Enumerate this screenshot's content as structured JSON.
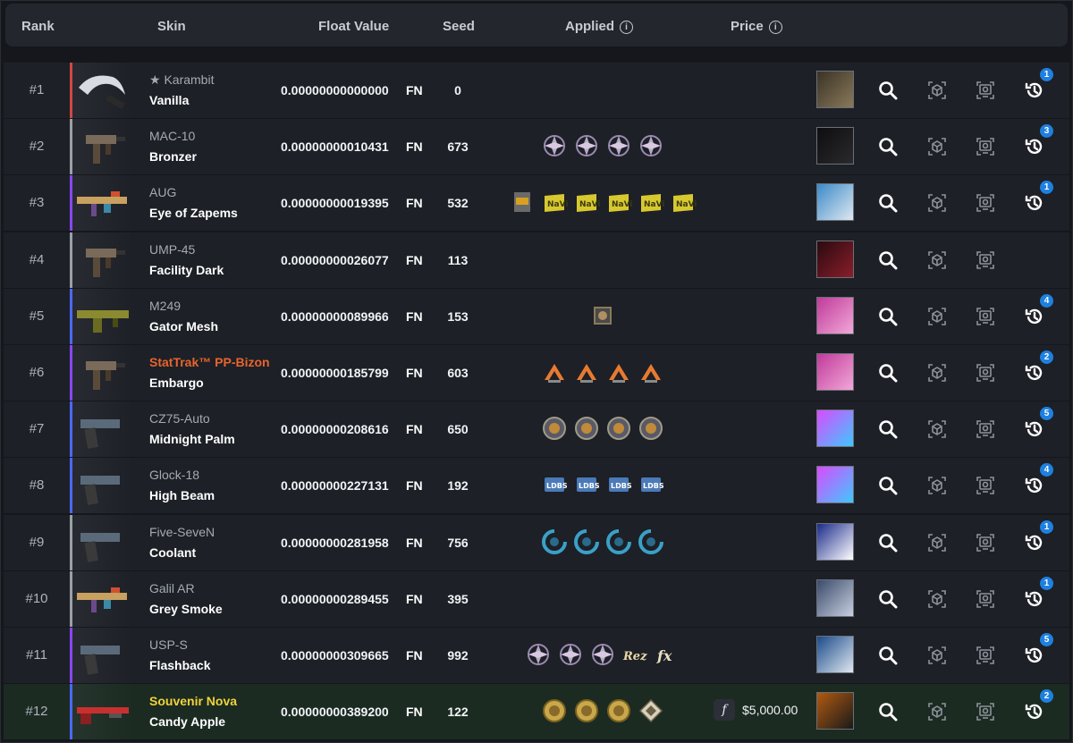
{
  "header": {
    "rank": "Rank",
    "skin": "Skin",
    "float_value": "Float Value",
    "seed": "Seed",
    "applied": "Applied",
    "price": "Price"
  },
  "colors": {
    "accent_badge": "#1e80e0",
    "stattrak": "#e8642e",
    "souvenir": "#f2d23a",
    "row_bg": "#1d2026",
    "souvenir_row_bg": "#1b2b22"
  },
  "icons": {
    "inspect": "magnifier-icon",
    "3d_view": "cube-scan-icon",
    "screenshot": "screen-inspect-icon",
    "history": "history-icon",
    "info": "info-icon",
    "float": "float-f-icon"
  },
  "rows": [
    {
      "rank": "#1",
      "weapon": "★ Karambit",
      "skin": "Vanilla",
      "float": "0.00000000000000",
      "wear": "FN",
      "seed": "0",
      "stickers": [],
      "price": "",
      "history_count": "1",
      "rarity": "#d24646",
      "name_color": "#a5aab4",
      "avatar": [
        "#3a3226",
        "#8a7a5a"
      ],
      "weapon_icon": "karambit"
    },
    {
      "rank": "#2",
      "weapon": "MAC-10",
      "skin": "Bronzer",
      "float": "0.00000000010431",
      "wear": "FN",
      "seed": "673",
      "stickers": [
        "nip",
        "nip",
        "nip",
        "nip"
      ],
      "price": "",
      "history_count": "3",
      "rarity": "#9aa0a8",
      "name_color": "#a5aab4",
      "avatar": [
        "#0e0e10",
        "#2a2a2e"
      ],
      "weapon_icon": "smg"
    },
    {
      "rank": "#3",
      "weapon": "AUG",
      "skin": "Eye of Zapems",
      "float": "0.00000000019395",
      "wear": "FN",
      "seed": "532",
      "stickers": [
        "box",
        "navi",
        "navi",
        "navi",
        "navi",
        "navi"
      ],
      "price": "",
      "history_count": "1",
      "rarity": "#8847ff",
      "name_color": "#a5aab4",
      "avatar": [
        "#3a8ac8",
        "#dfe8f0"
      ],
      "weapon_icon": "rifle"
    },
    {
      "rank": "#4",
      "weapon": "UMP-45",
      "skin": "Facility Dark",
      "float": "0.00000000026077",
      "wear": "FN",
      "seed": "113",
      "stickers": [],
      "price": "",
      "history_count": "",
      "rarity": "#9aa0a8",
      "name_color": "#a5aab4",
      "avatar": [
        "#2a0a10",
        "#8a1e2a"
      ],
      "weapon_icon": "smg"
    },
    {
      "rank": "#5",
      "weapon": "M249",
      "skin": "Gator Mesh",
      "float": "0.00000000089966",
      "wear": "FN",
      "seed": "153",
      "stickers": [
        "holo"
      ],
      "price": "",
      "history_count": "4",
      "rarity": "#4b69ff",
      "name_color": "#a5aab4",
      "avatar": [
        "#c03a9a",
        "#f2a8d8"
      ],
      "weapon_icon": "mg"
    },
    {
      "rank": "#6",
      "weapon": "StatTrak™ PP-Bizon",
      "skin": "Embargo",
      "float": "0.00000000185799",
      "wear": "FN",
      "seed": "603",
      "stickers": [
        "a",
        "a",
        "a",
        "a"
      ],
      "price": "",
      "history_count": "2",
      "rarity": "#8847ff",
      "name_color": "#e8642e",
      "avatar": [
        "#c03a9a",
        "#f2a8d8"
      ],
      "weapon_icon": "smg"
    },
    {
      "rank": "#7",
      "weapon": "CZ75-Auto",
      "skin": "Midnight Palm",
      "float": "0.00000000208616",
      "wear": "FN",
      "seed": "650",
      "stickers": [
        "coin",
        "coin",
        "coin",
        "coin"
      ],
      "price": "",
      "history_count": "5",
      "rarity": "#4b69ff",
      "name_color": "#a5aab4",
      "avatar": [
        "#d94bff",
        "#3fc8ff"
      ],
      "weapon_icon": "pistol"
    },
    {
      "rank": "#8",
      "weapon": "Glock-18",
      "skin": "High Beam",
      "float": "0.00000000227131",
      "wear": "FN",
      "seed": "192",
      "stickers": [
        "ldbs",
        "ldbs",
        "ldbs",
        "ldbs"
      ],
      "price": "",
      "history_count": "4",
      "rarity": "#4b69ff",
      "name_color": "#a5aab4",
      "avatar": [
        "#d94bff",
        "#3fc8ff"
      ],
      "weapon_icon": "pistol"
    },
    {
      "rank": "#9",
      "weapon": "Five-SeveN",
      "skin": "Coolant",
      "float": "0.00000000281958",
      "wear": "FN",
      "seed": "756",
      "stickers": [
        "liquid",
        "liquid",
        "liquid",
        "liquid"
      ],
      "price": "",
      "history_count": "1",
      "rarity": "#9aa0a8",
      "name_color": "#a5aab4",
      "avatar": [
        "#1a2a8a",
        "#ffffff"
      ],
      "weapon_icon": "pistol"
    },
    {
      "rank": "#10",
      "weapon": "Galil AR",
      "skin": "Grey Smoke",
      "float": "0.00000000289455",
      "wear": "FN",
      "seed": "395",
      "stickers": [],
      "price": "",
      "history_count": "1",
      "rarity": "#9aa0a8",
      "name_color": "#a5aab4",
      "avatar": [
        "#3a4a6a",
        "#c8d0e0"
      ],
      "weapon_icon": "rifle"
    },
    {
      "rank": "#11",
      "weapon": "USP-S",
      "skin": "Flashback",
      "float": "0.00000000309665",
      "wear": "FN",
      "seed": "992",
      "stickers": [
        "nip",
        "nip",
        "nip",
        "rez",
        "fx"
      ],
      "price": "",
      "history_count": "5",
      "rarity": "#8847ff",
      "name_color": "#a5aab4",
      "avatar": [
        "#1a4a8a",
        "#e0e8f0"
      ],
      "weapon_icon": "pistol"
    },
    {
      "rank": "#12",
      "weapon": "Souvenir Nova",
      "skin": "Candy Apple",
      "float": "0.00000000389200",
      "wear": "FN",
      "seed": "122",
      "stickers": [
        "gold",
        "gold",
        "gold",
        "diamond"
      ],
      "price": "$5,000.00",
      "history_count": "2",
      "rarity": "#4b69ff",
      "name_color": "#f2d23a",
      "avatar": [
        "#b05a10",
        "#1a1a1a"
      ],
      "weapon_icon": "shotgun",
      "souvenir": true
    }
  ]
}
